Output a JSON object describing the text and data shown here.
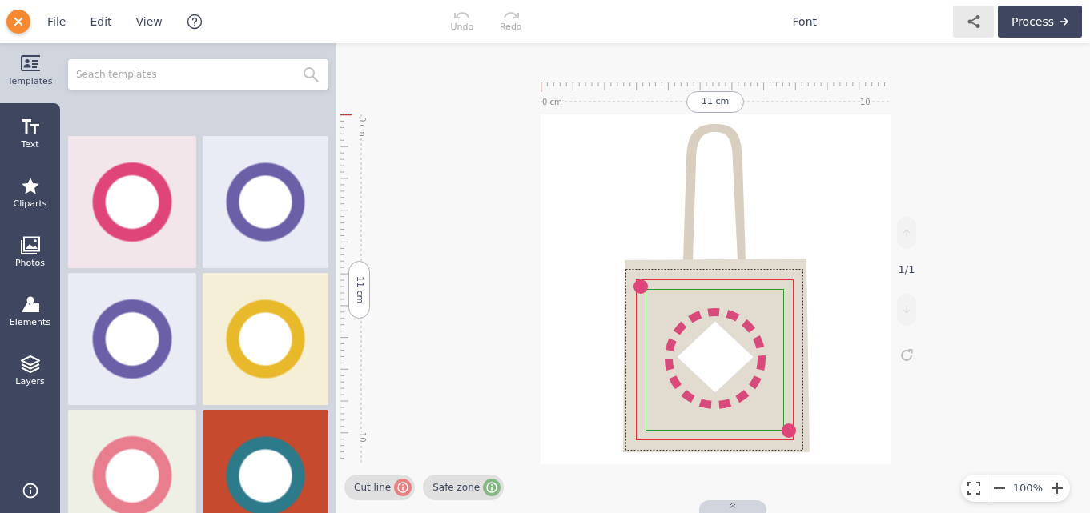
{
  "toolbar": {
    "menu": [
      "File",
      "Edit",
      "View"
    ],
    "history": [
      {
        "label": "Undo",
        "kind": "undo",
        "disabled": true
      },
      {
        "label": "Redo",
        "kind": "redo",
        "disabled": true
      }
    ],
    "title": "Font",
    "process_button": "Process"
  },
  "sidebar": {
    "items": [
      {
        "label": "Templates",
        "kind": "templates",
        "selected": true
      },
      {
        "label": "Text",
        "kind": "text",
        "selected": false
      },
      {
        "label": "Cliparts",
        "kind": "cliparts",
        "selected": false
      },
      {
        "label": "Photos",
        "kind": "photos",
        "selected": false
      },
      {
        "label": "Elements",
        "kind": "elements",
        "selected": false
      },
      {
        "label": "Layers",
        "kind": "layers",
        "selected": false
      }
    ]
  },
  "template_panel": {
    "search": {
      "placeholder": "Seach templates"
    }
  },
  "canvas": {
    "h_ruler": {
      "start": "0 cm",
      "end": "10",
      "size": "11 cm"
    },
    "v_ruler": {
      "start": "0 cm",
      "end": "10",
      "size": "11 cm"
    },
    "page_indicator": "1/1",
    "move_up": {
      "disabled": true
    },
    "move_down": {
      "disabled": true
    }
  },
  "guides": [
    {
      "label": "Cut line",
      "color": "#e88080"
    },
    {
      "label": "Safe zone",
      "color": "#86b886"
    }
  ],
  "zoom": {
    "value": "100%"
  }
}
